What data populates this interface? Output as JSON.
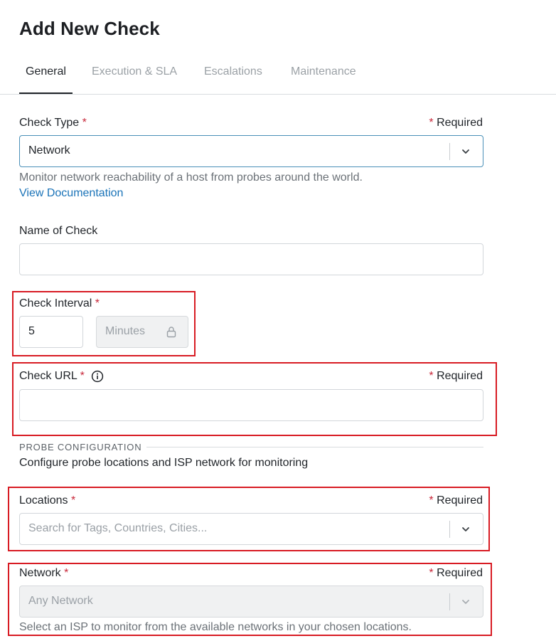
{
  "page": {
    "title": "Add New Check"
  },
  "tabs": [
    {
      "label": "General",
      "active": true
    },
    {
      "label": "Execution & SLA",
      "active": false
    },
    {
      "label": "Escalations",
      "active": false
    },
    {
      "label": "Maintenance",
      "active": false
    }
  ],
  "required_text": "Required",
  "required_star": "*",
  "check_type": {
    "label": "Check Type",
    "value": "Network",
    "help": "Monitor network reachability of a host from probes around the world.",
    "doc_link": "View Documentation"
  },
  "name_of_check": {
    "label": "Name of Check",
    "value": ""
  },
  "check_interval": {
    "label": "Check Interval",
    "value": "5",
    "unit": "Minutes"
  },
  "check_url": {
    "label": "Check URL",
    "value": ""
  },
  "probe_configuration": {
    "heading": "PROBE CONFIGURATION",
    "description": "Configure probe locations and ISP network for monitoring"
  },
  "locations": {
    "label": "Locations",
    "placeholder": "Search for Tags, Countries, Cities..."
  },
  "network": {
    "label": "Network",
    "value": "Any Network",
    "help": "Select an ISP to monitor from the available networks in your chosen locations."
  },
  "colors": {
    "accent": "#1a73b8",
    "required_star": "#c8283a",
    "highlight": "#d81b23"
  }
}
